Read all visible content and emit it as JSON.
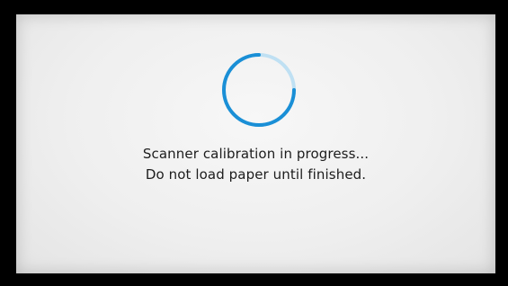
{
  "screen": {
    "spinner_icon": "loading-spinner-icon",
    "accent_color": "#1a8fd6",
    "track_color": "#bfe0f3",
    "message": {
      "line1": "Scanner calibration in progress...",
      "line2": "Do not load paper until finished."
    }
  }
}
